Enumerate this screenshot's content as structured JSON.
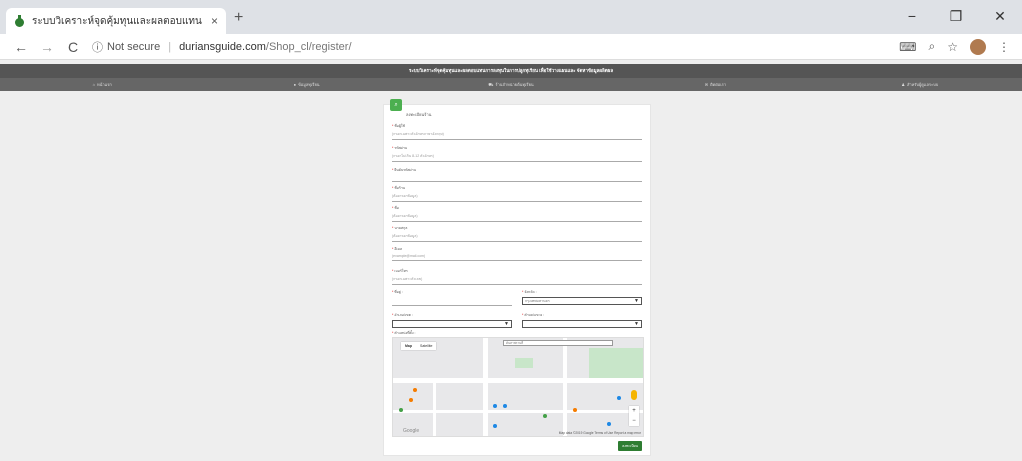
{
  "browser": {
    "tab_title": "ระบบวิเคราะห์จุดคุ้มทุนและผลตอบแทน",
    "tab_close": "×",
    "new_tab": "+",
    "back": "←",
    "forward": "→",
    "reload": "C",
    "info_icon": "ⓘ",
    "not_secure": "Not secure",
    "separator": "|",
    "url_host": "duriansguide.com",
    "url_path": "/Shop_cl/register/",
    "zoom_icon": "🔍",
    "star_icon": "☆",
    "menu_icon": "⋮",
    "minimize": "−",
    "restore": "❐",
    "close": "✕"
  },
  "site": {
    "banner": "ระบบวิเคราะห์จุดคุ้มทุนและผลตอบแทนการลงทุนในการปลูกทุเรียน เพื่อใช้วางแผนและ จัดหาข้อมูลผลิตผล",
    "nav": [
      {
        "icon": "home-icon",
        "glyph": "⌂",
        "label": "หน้าแรก"
      },
      {
        "icon": "durian-icon",
        "glyph": "●",
        "label": "ข้อมูลทุเรียน"
      },
      {
        "icon": "cart-icon",
        "glyph": "⛟",
        "label": "ร้านจำหน่ายต้นทุเรียน"
      },
      {
        "icon": "chat-icon",
        "glyph": "✉",
        "label": "ติดต่อเรา"
      },
      {
        "icon": "user-icon",
        "glyph": "♟",
        "label": "สำหรับผู้ดูแลระบบ"
      }
    ]
  },
  "form": {
    "icon_glyph": "⌕",
    "title": "ลงทะเบียนร้าน",
    "fields": [
      {
        "label": "ชื่อผู้ใช้",
        "placeholder": "(กรอกเฉพาะตัวอักษรภาษาอังกฤษ)"
      },
      {
        "label": "รหัสผ่าน",
        "placeholder": "(กรอกไม่เกิน 8-12 ตัวอักษร)"
      },
      {
        "label": "ยืนยันรหัสผ่าน",
        "placeholder": ""
      },
      {
        "label": "ชื่อร้าน",
        "placeholder": "(ต้องกรอกข้อมูล)"
      },
      {
        "label": "ชื่อ",
        "placeholder": "(ต้องกรอกข้อมูล)"
      },
      {
        "label": "นามสกุล",
        "placeholder": "(ต้องกรอกข้อมูล)"
      },
      {
        "label": "อีเมล",
        "placeholder": "(example@mail.com)"
      },
      {
        "label": "เบอร์โทร",
        "placeholder": "(กรอกเฉพาะตัวเลข)"
      }
    ],
    "address_label": "ที่อยู่ :",
    "province_label": "จังหวัด :",
    "province_value": "กรุงเทพมหานคร",
    "district_label": "อำเภอ/เขต :",
    "subdistrict_label": "ตำบล/แขวง :",
    "location_label": "ตำแหน่งที่ตั้ง :",
    "arrow": "▼",
    "map": {
      "tab_map": "Map",
      "tab_satellite": "Satellite",
      "search_placeholder": "ค้นหาสถานที่",
      "google": "Google",
      "terms": "Map data ©2019 Google  Terms of Use  Report a map error",
      "zoom_in": "+",
      "zoom_out": "−"
    },
    "submit": "ลงทะเบียน"
  }
}
